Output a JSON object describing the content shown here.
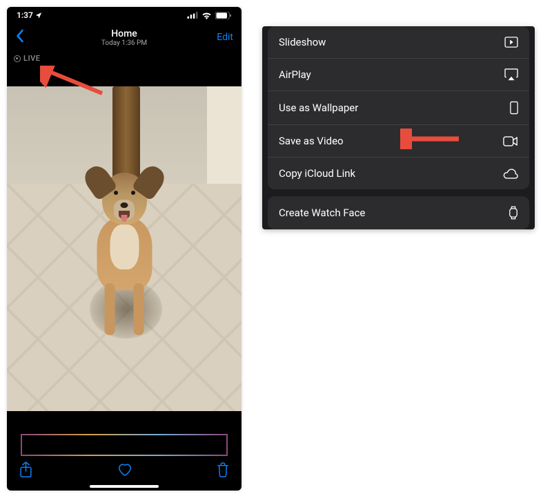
{
  "status_bar": {
    "time": "1:37",
    "location_icon": "location-arrow"
  },
  "nav": {
    "title": "Home",
    "subtitle": "Today 1:36 PM",
    "edit_label": "Edit"
  },
  "live_badge": {
    "label": "LIVE"
  },
  "action_sheet": {
    "group1": [
      {
        "label": "Slideshow",
        "icon": "play-square"
      },
      {
        "label": "AirPlay",
        "icon": "airplay"
      },
      {
        "label": "Use as Wallpaper",
        "icon": "phone-outline"
      },
      {
        "label": "Save as Video",
        "icon": "video-camera"
      },
      {
        "label": "Copy iCloud Link",
        "icon": "cloud"
      }
    ],
    "group2": [
      {
        "label": "Create Watch Face",
        "icon": "watch"
      }
    ]
  },
  "colors": {
    "ios_blue": "#0a84ff",
    "arrow_red": "#e74c3c",
    "sheet_bg": "#2c2c2e"
  }
}
